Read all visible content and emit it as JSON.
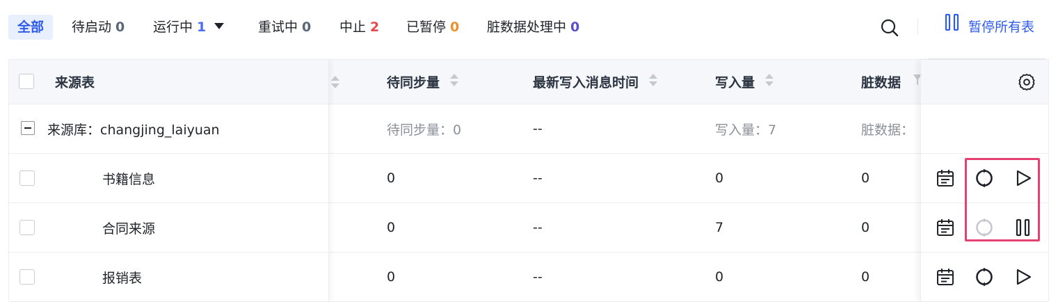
{
  "filters": [
    {
      "label": "全部",
      "count": ""
    },
    {
      "label": "待启动",
      "count": "0"
    },
    {
      "label": "运行中",
      "count": "1"
    },
    {
      "label": "重试中",
      "count": "0"
    },
    {
      "label": "中止",
      "count": "2"
    },
    {
      "label": "已暂停",
      "count": "0"
    },
    {
      "label": "脏数据处理中",
      "count": "0"
    }
  ],
  "colors": {
    "active_tab_bg": "#e8effd",
    "accent": "#2f5bea",
    "count_waiting": "#5b6676",
    "count_running": "#4a6cf7",
    "count_abort": "#e5484d",
    "count_paused": "#e8912d",
    "count_dirty": "#5a4fc9",
    "highlight": "#e63f72"
  },
  "toolbar": {
    "pause_all_label": "暂停所有表",
    "search_icon": "search-icon",
    "pause_icon": "pause-icon"
  },
  "table": {
    "headers": {
      "source": "来源表",
      "pending": "待同步量",
      "latest_time": "最新写入消息时间",
      "write_count": "写入量",
      "dirty": "脏数据"
    },
    "group": {
      "label": "来源库：changjing_laiyuan",
      "pending": "待同步量：0",
      "latest_time": "--",
      "write_count": "写入量：7",
      "dirty": "脏数据："
    },
    "rows": [
      {
        "name": "书籍信息",
        "pending": "0",
        "latest_time": "--",
        "write_count": "0",
        "dirty": "0",
        "toggle_icon": "play-icon",
        "sync_disabled": false
      },
      {
        "name": "合同来源",
        "pending": "0",
        "latest_time": "--",
        "write_count": "7",
        "dirty": "0",
        "toggle_icon": "pause-icon",
        "sync_disabled": true
      },
      {
        "name": "报销表",
        "pending": "0",
        "latest_time": "--",
        "write_count": "0",
        "dirty": "0",
        "toggle_icon": "play-icon",
        "sync_disabled": false
      }
    ]
  }
}
